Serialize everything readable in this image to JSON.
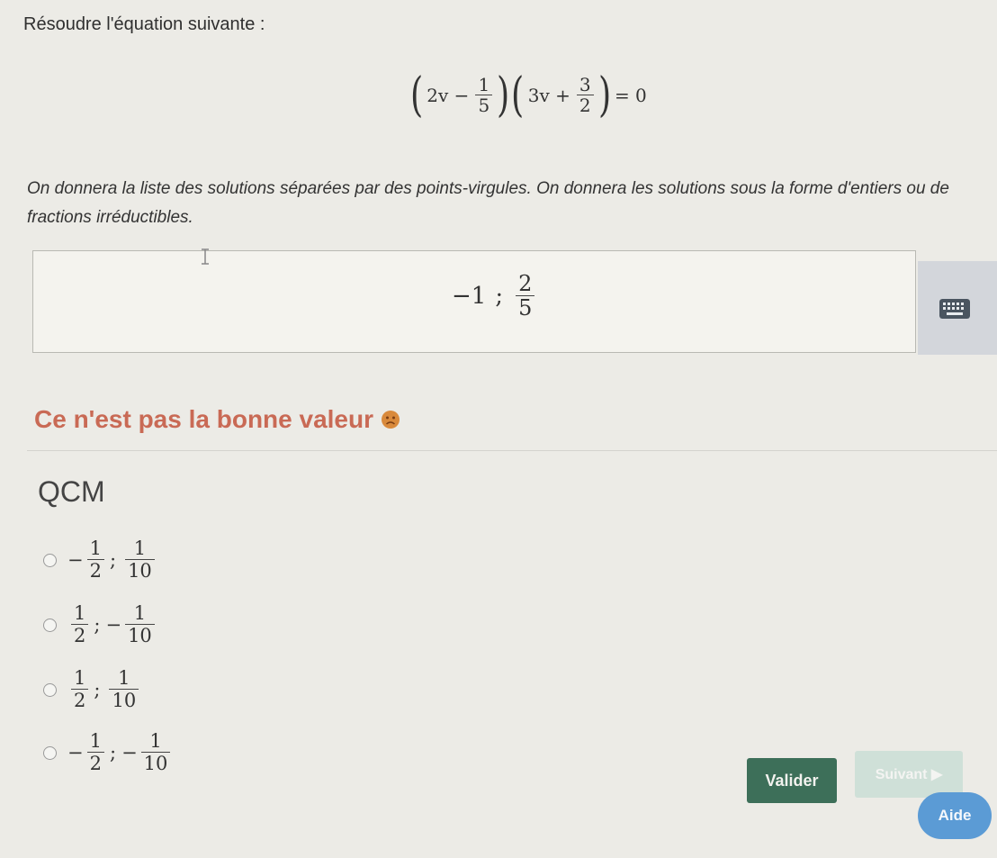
{
  "question": {
    "prompt": "Résoudre l'équation suivante :",
    "equation": {
      "factor1_left": "2v −",
      "factor1_num": "1",
      "factor1_den": "5",
      "factor2_left": "3v +",
      "factor2_num": "3",
      "factor2_den": "2",
      "rhs": "= 0"
    },
    "instructions": "On donnera la liste des solutions séparées par des points-virgules. On donnera les solutions sous la forme d'entiers ou de fractions irréductibles."
  },
  "answer": {
    "part1": "−1",
    "separator": ";",
    "frac_num": "2",
    "frac_den": "5"
  },
  "feedback": {
    "text": "Ce n'est pas la bonne valeur",
    "color": "#c96a55"
  },
  "qcm": {
    "title": "QCM",
    "options": [
      {
        "sign1": "−",
        "n1": "1",
        "d1": "2",
        "sep": ";",
        "sign2": "",
        "n2": "1",
        "d2": "10"
      },
      {
        "sign1": "",
        "n1": "1",
        "d1": "2",
        "sep": ";",
        "sign2": "−",
        "n2": "1",
        "d2": "10"
      },
      {
        "sign1": "",
        "n1": "1",
        "d1": "2",
        "sep": ";",
        "sign2": "",
        "n2": "1",
        "d2": "10"
      },
      {
        "sign1": "−",
        "n1": "1",
        "d1": "2",
        "sep": ";",
        "sign2": "−",
        "n2": "1",
        "d2": "10"
      }
    ]
  },
  "buttons": {
    "valider": "Valider",
    "suivant": "Suivant ▶",
    "aide": "Aide"
  },
  "icons": {
    "keyboard": "keyboard-icon",
    "feedback_emoji": "sad-face-icon",
    "text_cursor": "text-cursor-icon"
  },
  "colors": {
    "valider_bg": "#3d6f59",
    "suivant_bg": "#cfe0d8",
    "aide_bg": "#5b9bd5"
  }
}
